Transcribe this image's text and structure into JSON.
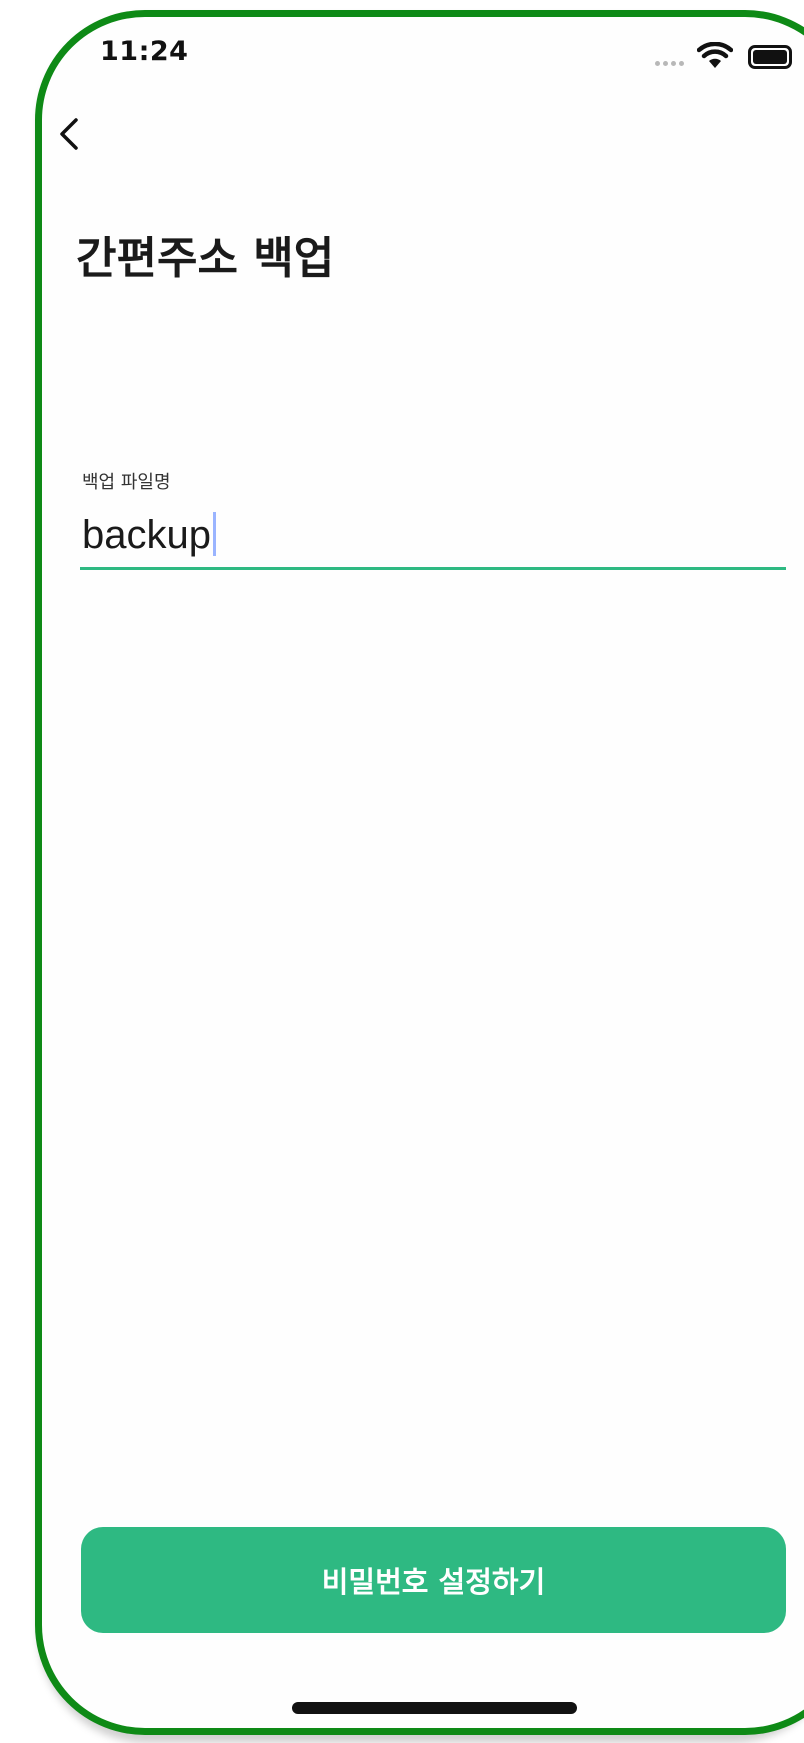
{
  "status_bar": {
    "time": "11:24",
    "icons": [
      "signal-dots-icon",
      "wifi-icon",
      "battery-icon"
    ]
  },
  "nav": {
    "back_icon": "chevron-left-icon"
  },
  "page": {
    "title": "간편주소 백업"
  },
  "form": {
    "filename_label": "백업 파일명",
    "filename_value": "backup"
  },
  "actions": {
    "submit_label": "비밀번호 설정하기"
  },
  "colors": {
    "frame": "#0e8a16",
    "accent": "#2eb982",
    "caret": "#9ab4ff"
  }
}
